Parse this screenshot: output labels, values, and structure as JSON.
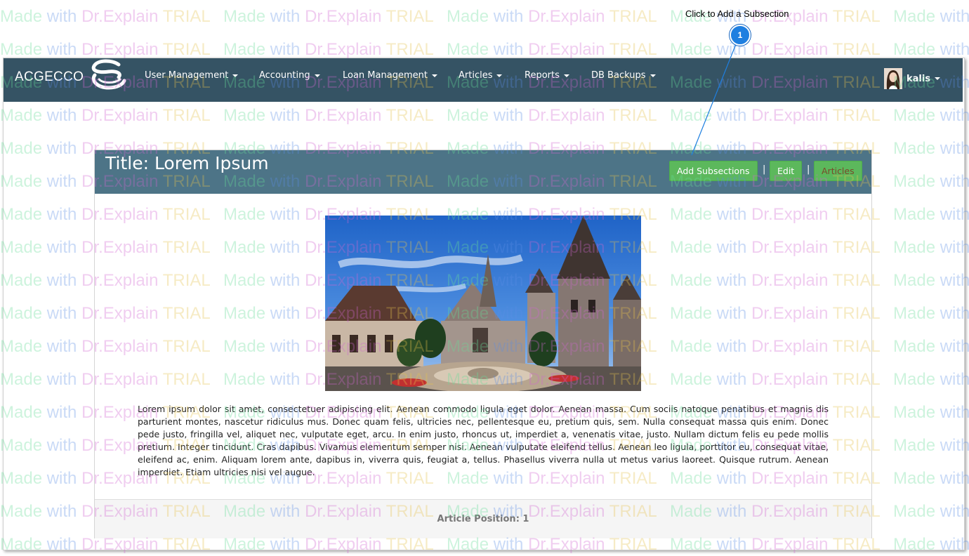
{
  "callout": {
    "text": "Click to Add a Subsection",
    "number": "1"
  },
  "watermark": {
    "w1": "Made",
    "w2": "with",
    "w3": "Dr.Explain",
    "w4": "TRIAL"
  },
  "navbar": {
    "brand": "ACGECCO",
    "menu": [
      {
        "label": "User Management"
      },
      {
        "label": "Accounting"
      },
      {
        "label": "Loan Management"
      },
      {
        "label": "Articles"
      },
      {
        "label": "Reports"
      },
      {
        "label": "DB Backups"
      }
    ],
    "user": {
      "name": "kalis"
    },
    "colors": {
      "background": "#355364"
    }
  },
  "article": {
    "title": "Title: Lorem Ipsum",
    "buttons": {
      "add_subsections": "Add Subsections",
      "separator": "|",
      "edit": "Edit",
      "articles": "Articles"
    },
    "body": "Lorem ipsum dolor sit amet, consectetuer adipiscing elit. Aenean commodo ligula eget dolor. Aenean massa. Cum sociis natoque penatibus et magnis dis parturient montes, nascetur ridiculus mus. Donec quam felis, ultricies nec, pellentesque eu, pretium quis, sem. Nulla consequat massa quis enim. Donec pede justo, fringilla vel, aliquet nec, vulputate eget, arcu. In enim justo, rhoncus ut, imperdiet a, venenatis vitae, justo. Nullam dictum felis eu pede mollis pretium. Integer tincidunt. Cras dapibus. Vivamus elementum semper nisi. Aenean vulputate eleifend tellus. Aenean leo ligula, porttitor eu, consequat vitae, eleifend ac, enim. Aliquam lorem ante, dapibus in, viverra quis, feugiat a, tellus. Phasellus viverra nulla ut metus varius laoreet. Quisque rutrum. Aenean imperdiet. Etiam ultricies nisi vel augue.",
    "footer": "Article Position: 1",
    "colors": {
      "heading": "#4d7487",
      "button": "#5cb85c"
    }
  }
}
